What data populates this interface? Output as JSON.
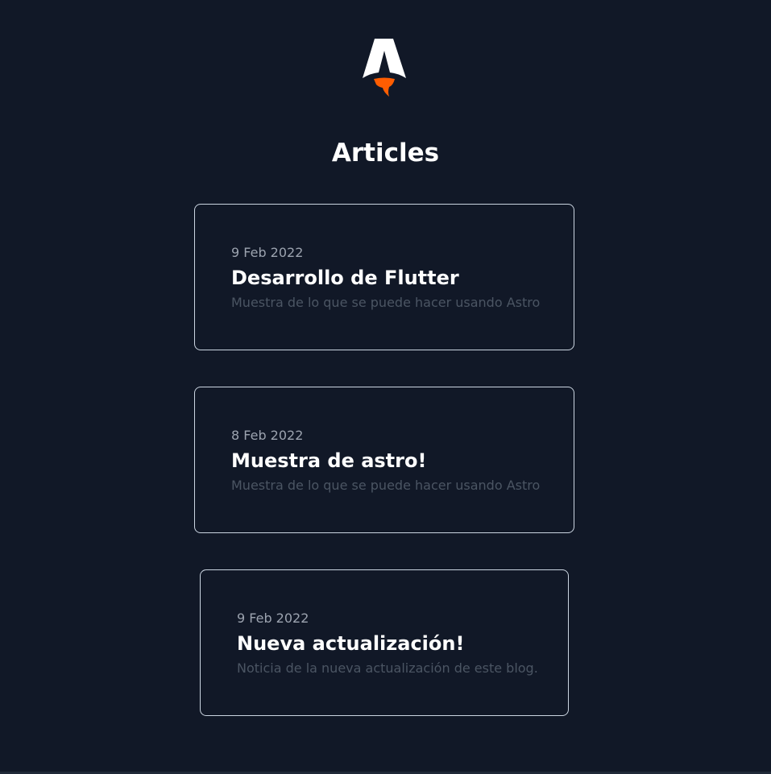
{
  "header": {
    "logo_icon": "astro-rocket-icon",
    "title": "Articles"
  },
  "articles": [
    {
      "date": "9 Feb 2022",
      "title": "Desarrollo de Flutter",
      "description": "Muestra de lo que se puede hacer usando Astro"
    },
    {
      "date": "8 Feb 2022",
      "title": "Muestra de astro!",
      "description": "Muestra de lo que se puede hacer usando Astro"
    },
    {
      "date": "9 Feb 2022",
      "title": "Nueva actualización!",
      "description": "Noticia de la nueva actualización de este blog."
    }
  ],
  "colors": {
    "background": "#111827",
    "card_border": "#cbd5e1",
    "logo_flame": "#ff5d01"
  }
}
